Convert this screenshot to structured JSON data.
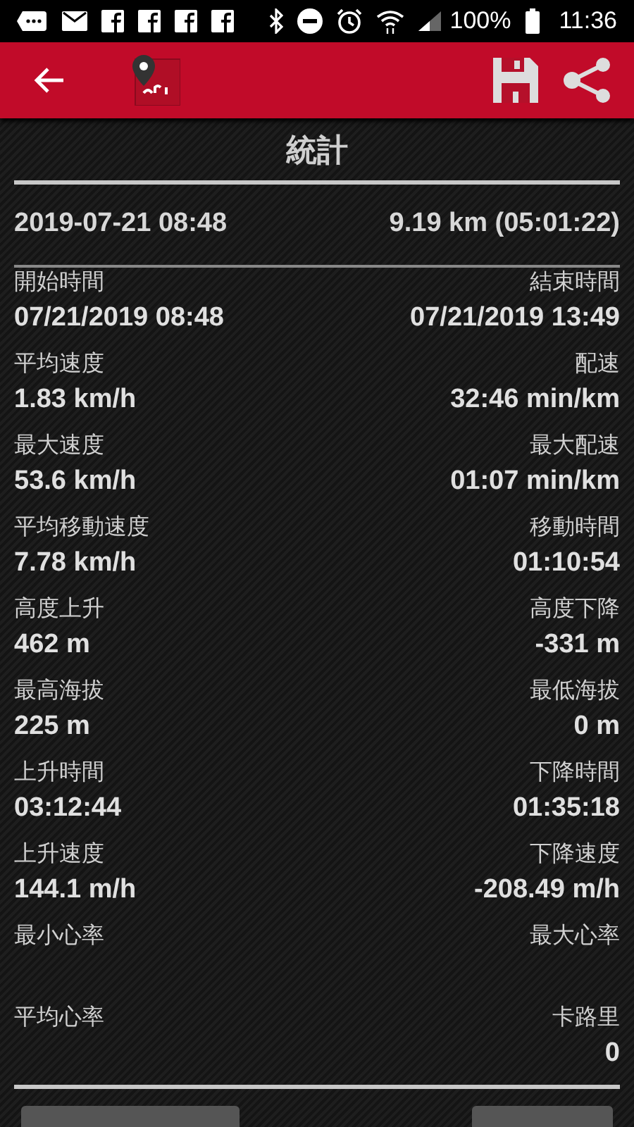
{
  "status_bar": {
    "battery": "100%",
    "time": "11:36"
  },
  "title": "統計",
  "summary": {
    "date": "2019-07-21 08:48",
    "distance": "9.19 km (05:01:22)"
  },
  "stats": [
    {
      "left": {
        "label": "開始時間",
        "value": "07/21/2019 08:48"
      },
      "right": {
        "label": "結束時間",
        "value": "07/21/2019 13:49"
      }
    },
    {
      "left": {
        "label": "平均速度",
        "value": "1.83 km/h"
      },
      "right": {
        "label": "配速",
        "value": "32:46 min/km"
      }
    },
    {
      "left": {
        "label": "最大速度",
        "value": "53.6 km/h"
      },
      "right": {
        "label": "最大配速",
        "value": "01:07 min/km"
      }
    },
    {
      "left": {
        "label": "平均移動速度",
        "value": "7.78 km/h"
      },
      "right": {
        "label": "移動時間",
        "value": "01:10:54"
      }
    },
    {
      "left": {
        "label": "高度上升",
        "value": "462 m"
      },
      "right": {
        "label": "高度下降",
        "value": "-331 m"
      }
    },
    {
      "left": {
        "label": "最高海拔",
        "value": "225 m"
      },
      "right": {
        "label": "最低海拔",
        "value": "0 m"
      }
    },
    {
      "left": {
        "label": "上升時間",
        "value": "03:12:44"
      },
      "right": {
        "label": "下降時間",
        "value": "01:35:18"
      }
    },
    {
      "left": {
        "label": "上升速度",
        "value": "144.1 m/h"
      },
      "right": {
        "label": "下降速度",
        "value": "-208.49 m/h"
      }
    },
    {
      "left": {
        "label": "最小心率"
      },
      "right": {
        "label": "最大心率"
      }
    },
    {
      "left": {
        "label": "平均心率"
      },
      "right": {
        "label": "卡路里",
        "value": "0"
      }
    }
  ]
}
